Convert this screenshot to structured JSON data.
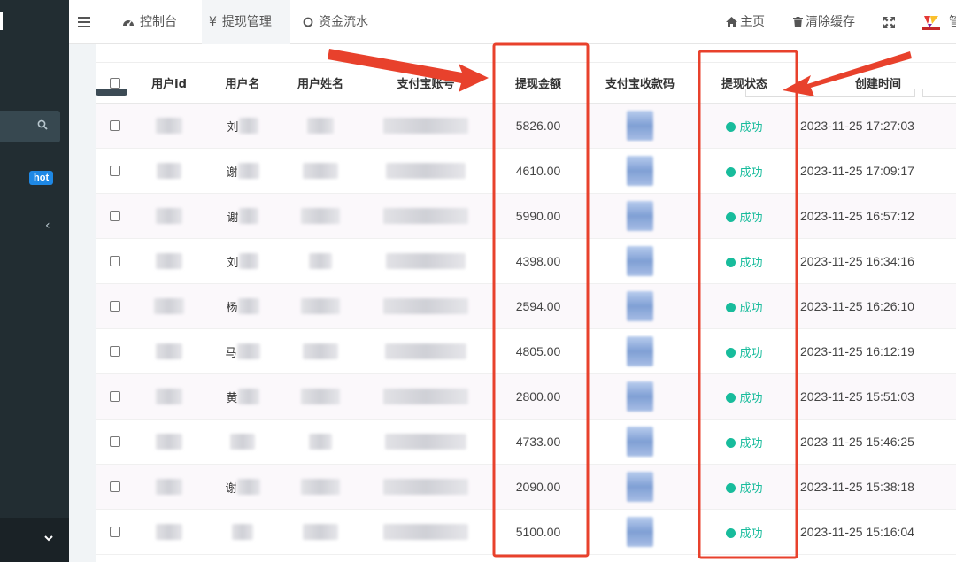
{
  "topnav": {
    "menu_icon": "hamburger-icon",
    "tabs": [
      {
        "label": "控制台",
        "icon": "dashboard-icon"
      },
      {
        "label": "提现管理",
        "icon": "yen-icon"
      },
      {
        "label": "资金流水",
        "icon": "circle-icon"
      }
    ],
    "home": "主页",
    "clear_cache": "清除缓存",
    "fullscreen_icon": "expand-icon",
    "username_fragment": "管"
  },
  "sidebar": {
    "hot_badge": "hot",
    "collapse_icon": "chevron-left-icon",
    "bottom_icon": "chevron-down-icon"
  },
  "table": {
    "headers": [
      "",
      "用户id",
      "用户名",
      "用户姓名",
      "支付宝账号",
      "提现金额",
      "支付宝收款码",
      "提现状态",
      "创建时间"
    ],
    "rows": [
      {
        "name_prefix": "刘",
        "amount": "5826.00",
        "status": "成功",
        "created": "2023-11-25 17:27:03"
      },
      {
        "name_prefix": "谢",
        "amount": "4610.00",
        "status": "成功",
        "created": "2023-11-25 17:09:17"
      },
      {
        "name_prefix": "谢",
        "amount": "5990.00",
        "status": "成功",
        "created": "2023-11-25 16:57:12"
      },
      {
        "name_prefix": "刘",
        "amount": "4398.00",
        "status": "成功",
        "created": "2023-11-25 16:34:16"
      },
      {
        "name_prefix": "杨",
        "amount": "2594.00",
        "status": "成功",
        "created": "2023-11-25 16:26:10"
      },
      {
        "name_prefix": "马",
        "amount": "4805.00",
        "status": "成功",
        "created": "2023-11-25 16:12:19"
      },
      {
        "name_prefix": "黄",
        "amount": "2800.00",
        "status": "成功",
        "created": "2023-11-25 15:51:03"
      },
      {
        "name_prefix": "",
        "amount": "4733.00",
        "status": "成功",
        "created": "2023-11-25 15:46:25"
      },
      {
        "name_prefix": "谢",
        "amount": "2090.00",
        "status": "成功",
        "created": "2023-11-25 15:38:18"
      },
      {
        "name_prefix": "",
        "amount": "5100.00",
        "status": "成功",
        "created": "2023-11-25 15:16:04"
      }
    ]
  },
  "colors": {
    "sidebar_bg": "#222d32",
    "status_success": "#18bc9c",
    "annotation_red": "#e8412c",
    "hot_badge": "#1e88e5"
  }
}
